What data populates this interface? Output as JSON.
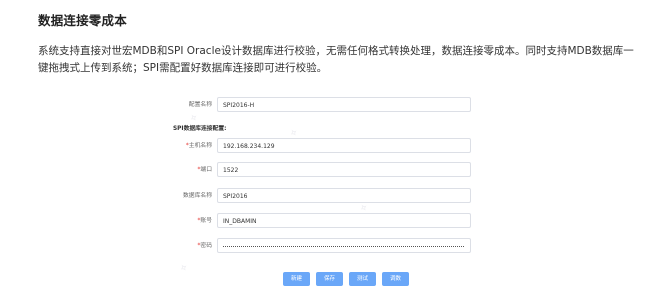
{
  "header": {
    "title": "数据连接零成本",
    "description": "系统支持直接对世宏MDB和SPI Oracle设计数据库进行校验，无需任何格式转换处理，数据连接零成本。同时支持MDB数据库一键拖拽式上传到系统；SPI需配置好数据库连接即可进行校验。"
  },
  "form": {
    "config_name": {
      "label": "配置名称",
      "value": "SPI2016-H"
    },
    "section_title": "SPI数据库连接配置:",
    "host": {
      "label": "主机名称",
      "value": "192.168.234.129",
      "required_mark": "*"
    },
    "port": {
      "label": "端口",
      "value": "1522",
      "required_mark": "*"
    },
    "db_name": {
      "label": "数据库名称",
      "value": "SPI2016"
    },
    "account": {
      "label": "账号",
      "value": "IN_DBAMIN",
      "required_mark": "*"
    },
    "password": {
      "label": "密码",
      "value": "",
      "required_mark": "*"
    }
  },
  "buttons": {
    "new": "新建",
    "save": "保存",
    "test": "测试",
    "debug": "调数"
  },
  "colors": {
    "button_bg": "#6aa7f8",
    "required": "#e53935"
  }
}
